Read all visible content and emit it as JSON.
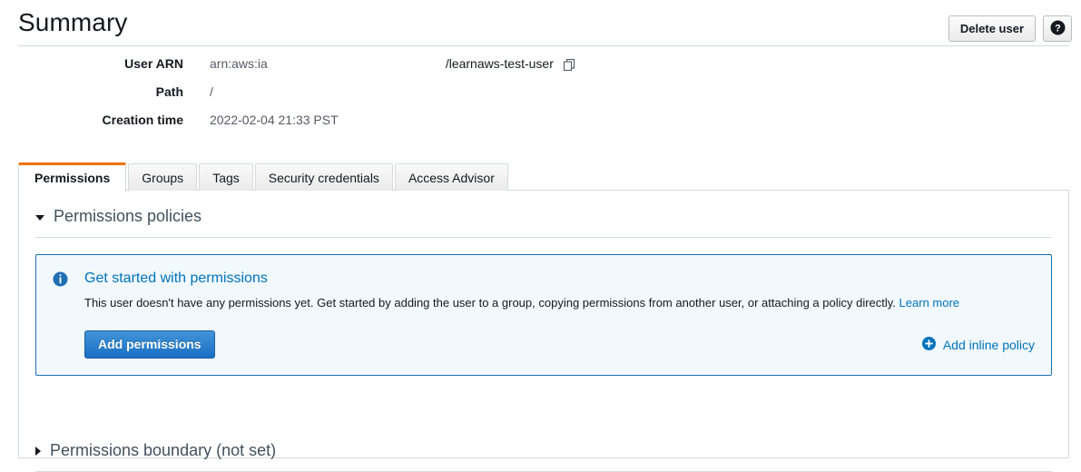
{
  "header": {
    "title": "Summary",
    "delete_user_label": "Delete user",
    "help_icon": "help-circle-icon"
  },
  "details": [
    {
      "label": "User ARN",
      "value_prefix": "arn:aws:ia",
      "value_redacted": true,
      "value_suffix": "/learnaws-test-user",
      "copy_icon": "copy-icon"
    },
    {
      "label": "Path",
      "value_prefix": "/",
      "value_redacted": false,
      "value_suffix": "",
      "copy_icon": ""
    },
    {
      "label": "Creation time",
      "value_prefix": "2022-02-04 21:33 PST",
      "value_redacted": false,
      "value_suffix": "",
      "copy_icon": ""
    }
  ],
  "tabs": [
    {
      "label": "Permissions",
      "active": true
    },
    {
      "label": "Groups",
      "active": false
    },
    {
      "label": "Tags",
      "active": false
    },
    {
      "label": "Security credentials",
      "active": false
    },
    {
      "label": "Access Advisor",
      "active": false
    }
  ],
  "permissions_section": {
    "title": "Permissions policies",
    "expanded": true,
    "caret_icon": "caret-down-icon"
  },
  "alert": {
    "icon": "info-circle-icon",
    "title": "Get started with permissions",
    "text": "This user doesn't have any permissions yet. Get started by adding the user to a group, copying permissions from another user, or attaching a policy directly. ",
    "link_label": "Learn more",
    "primary_button_label": "Add permissions",
    "inline_policy_icon": "plus-circle-icon",
    "inline_policy_label": "Add inline policy"
  },
  "boundary_section": {
    "title": "Permissions boundary (not set)",
    "expanded": false,
    "caret_icon": "caret-right-icon"
  },
  "colors": {
    "accent_orange": "#ec7211",
    "link_blue": "#0073bb",
    "alert_border": "#1f6fb2",
    "alert_bg": "#f1f8fe",
    "primary_button": "#1a6fc4",
    "border_gray": "#d5dbdb",
    "text_dark": "#16191f",
    "text_muted": "#545b64"
  }
}
